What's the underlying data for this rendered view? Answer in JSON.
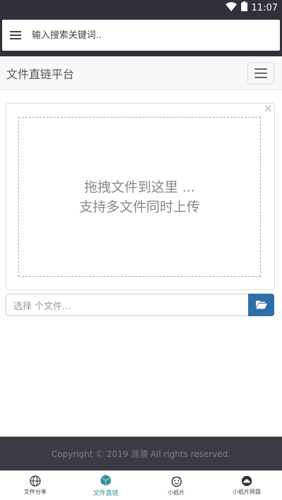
{
  "status_bar": {
    "time": "11:07",
    "icons": [
      "wifi-icon",
      "battery-icon"
    ]
  },
  "search": {
    "placeholder": "输入搜索关键词.."
  },
  "navbar": {
    "brand": "文件直链平台"
  },
  "dropzone": {
    "close_glyph": "×",
    "line1": "拖拽文件到这里 ...",
    "line2": "支持多文件同时上传"
  },
  "file_input": {
    "caption": "选择 个文件..."
  },
  "footer": {
    "copyright": "Copyright Ⓒ 2019 涟漪 All rights reserved."
  },
  "tabs": [
    {
      "label": "文件分享",
      "icon": "globe-icon",
      "active": false
    },
    {
      "label": "文件直链",
      "icon": "cube-icon",
      "active": true
    },
    {
      "label": "小纸片",
      "icon": "smiley-icon",
      "active": false
    },
    {
      "label": "小纸片网盘",
      "icon": "cloud-icon",
      "active": false
    }
  ],
  "colors": {
    "accent": "#2f8f97",
    "button": "#2f6fa8",
    "dark": "#30313a"
  }
}
